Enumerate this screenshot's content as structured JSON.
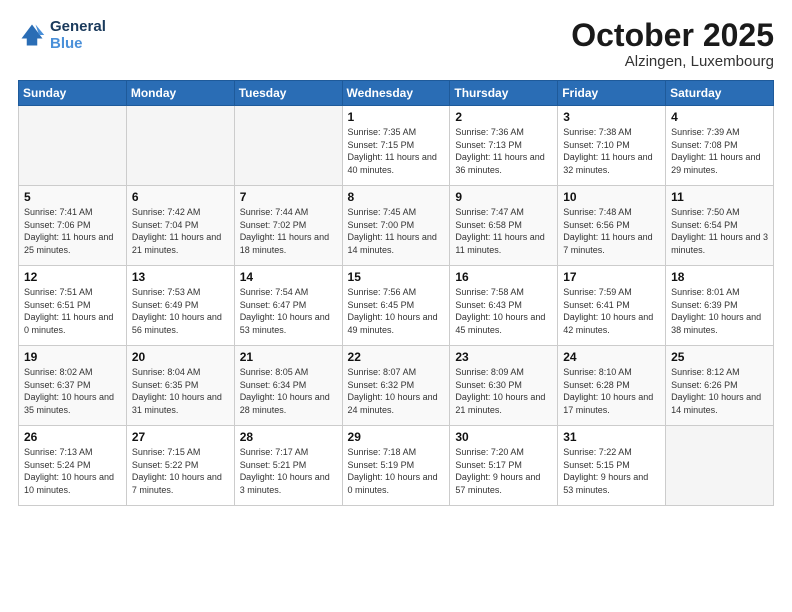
{
  "header": {
    "logo_line1": "General",
    "logo_line2": "Blue",
    "month": "October 2025",
    "location": "Alzingen, Luxembourg"
  },
  "weekdays": [
    "Sunday",
    "Monday",
    "Tuesday",
    "Wednesday",
    "Thursday",
    "Friday",
    "Saturday"
  ],
  "weeks": [
    [
      {
        "day": "",
        "sunrise": "",
        "sunset": "",
        "daylight": "",
        "empty": true
      },
      {
        "day": "",
        "sunrise": "",
        "sunset": "",
        "daylight": "",
        "empty": true
      },
      {
        "day": "",
        "sunrise": "",
        "sunset": "",
        "daylight": "",
        "empty": true
      },
      {
        "day": "1",
        "sunrise": "Sunrise: 7:35 AM",
        "sunset": "Sunset: 7:15 PM",
        "daylight": "Daylight: 11 hours and 40 minutes."
      },
      {
        "day": "2",
        "sunrise": "Sunrise: 7:36 AM",
        "sunset": "Sunset: 7:13 PM",
        "daylight": "Daylight: 11 hours and 36 minutes."
      },
      {
        "day": "3",
        "sunrise": "Sunrise: 7:38 AM",
        "sunset": "Sunset: 7:10 PM",
        "daylight": "Daylight: 11 hours and 32 minutes."
      },
      {
        "day": "4",
        "sunrise": "Sunrise: 7:39 AM",
        "sunset": "Sunset: 7:08 PM",
        "daylight": "Daylight: 11 hours and 29 minutes."
      }
    ],
    [
      {
        "day": "5",
        "sunrise": "Sunrise: 7:41 AM",
        "sunset": "Sunset: 7:06 PM",
        "daylight": "Daylight: 11 hours and 25 minutes."
      },
      {
        "day": "6",
        "sunrise": "Sunrise: 7:42 AM",
        "sunset": "Sunset: 7:04 PM",
        "daylight": "Daylight: 11 hours and 21 minutes."
      },
      {
        "day": "7",
        "sunrise": "Sunrise: 7:44 AM",
        "sunset": "Sunset: 7:02 PM",
        "daylight": "Daylight: 11 hours and 18 minutes."
      },
      {
        "day": "8",
        "sunrise": "Sunrise: 7:45 AM",
        "sunset": "Sunset: 7:00 PM",
        "daylight": "Daylight: 11 hours and 14 minutes."
      },
      {
        "day": "9",
        "sunrise": "Sunrise: 7:47 AM",
        "sunset": "Sunset: 6:58 PM",
        "daylight": "Daylight: 11 hours and 11 minutes."
      },
      {
        "day": "10",
        "sunrise": "Sunrise: 7:48 AM",
        "sunset": "Sunset: 6:56 PM",
        "daylight": "Daylight: 11 hours and 7 minutes."
      },
      {
        "day": "11",
        "sunrise": "Sunrise: 7:50 AM",
        "sunset": "Sunset: 6:54 PM",
        "daylight": "Daylight: 11 hours and 3 minutes."
      }
    ],
    [
      {
        "day": "12",
        "sunrise": "Sunrise: 7:51 AM",
        "sunset": "Sunset: 6:51 PM",
        "daylight": "Daylight: 11 hours and 0 minutes."
      },
      {
        "day": "13",
        "sunrise": "Sunrise: 7:53 AM",
        "sunset": "Sunset: 6:49 PM",
        "daylight": "Daylight: 10 hours and 56 minutes."
      },
      {
        "day": "14",
        "sunrise": "Sunrise: 7:54 AM",
        "sunset": "Sunset: 6:47 PM",
        "daylight": "Daylight: 10 hours and 53 minutes."
      },
      {
        "day": "15",
        "sunrise": "Sunrise: 7:56 AM",
        "sunset": "Sunset: 6:45 PM",
        "daylight": "Daylight: 10 hours and 49 minutes."
      },
      {
        "day": "16",
        "sunrise": "Sunrise: 7:58 AM",
        "sunset": "Sunset: 6:43 PM",
        "daylight": "Daylight: 10 hours and 45 minutes."
      },
      {
        "day": "17",
        "sunrise": "Sunrise: 7:59 AM",
        "sunset": "Sunset: 6:41 PM",
        "daylight": "Daylight: 10 hours and 42 minutes."
      },
      {
        "day": "18",
        "sunrise": "Sunrise: 8:01 AM",
        "sunset": "Sunset: 6:39 PM",
        "daylight": "Daylight: 10 hours and 38 minutes."
      }
    ],
    [
      {
        "day": "19",
        "sunrise": "Sunrise: 8:02 AM",
        "sunset": "Sunset: 6:37 PM",
        "daylight": "Daylight: 10 hours and 35 minutes."
      },
      {
        "day": "20",
        "sunrise": "Sunrise: 8:04 AM",
        "sunset": "Sunset: 6:35 PM",
        "daylight": "Daylight: 10 hours and 31 minutes."
      },
      {
        "day": "21",
        "sunrise": "Sunrise: 8:05 AM",
        "sunset": "Sunset: 6:34 PM",
        "daylight": "Daylight: 10 hours and 28 minutes."
      },
      {
        "day": "22",
        "sunrise": "Sunrise: 8:07 AM",
        "sunset": "Sunset: 6:32 PM",
        "daylight": "Daylight: 10 hours and 24 minutes."
      },
      {
        "day": "23",
        "sunrise": "Sunrise: 8:09 AM",
        "sunset": "Sunset: 6:30 PM",
        "daylight": "Daylight: 10 hours and 21 minutes."
      },
      {
        "day": "24",
        "sunrise": "Sunrise: 8:10 AM",
        "sunset": "Sunset: 6:28 PM",
        "daylight": "Daylight: 10 hours and 17 minutes."
      },
      {
        "day": "25",
        "sunrise": "Sunrise: 8:12 AM",
        "sunset": "Sunset: 6:26 PM",
        "daylight": "Daylight: 10 hours and 14 minutes."
      }
    ],
    [
      {
        "day": "26",
        "sunrise": "Sunrise: 7:13 AM",
        "sunset": "Sunset: 5:24 PM",
        "daylight": "Daylight: 10 hours and 10 minutes."
      },
      {
        "day": "27",
        "sunrise": "Sunrise: 7:15 AM",
        "sunset": "Sunset: 5:22 PM",
        "daylight": "Daylight: 10 hours and 7 minutes."
      },
      {
        "day": "28",
        "sunrise": "Sunrise: 7:17 AM",
        "sunset": "Sunset: 5:21 PM",
        "daylight": "Daylight: 10 hours and 3 minutes."
      },
      {
        "day": "29",
        "sunrise": "Sunrise: 7:18 AM",
        "sunset": "Sunset: 5:19 PM",
        "daylight": "Daylight: 10 hours and 0 minutes."
      },
      {
        "day": "30",
        "sunrise": "Sunrise: 7:20 AM",
        "sunset": "Sunset: 5:17 PM",
        "daylight": "Daylight: 9 hours and 57 minutes."
      },
      {
        "day": "31",
        "sunrise": "Sunrise: 7:22 AM",
        "sunset": "Sunset: 5:15 PM",
        "daylight": "Daylight: 9 hours and 53 minutes."
      },
      {
        "day": "",
        "sunrise": "",
        "sunset": "",
        "daylight": "",
        "empty": true
      }
    ]
  ]
}
